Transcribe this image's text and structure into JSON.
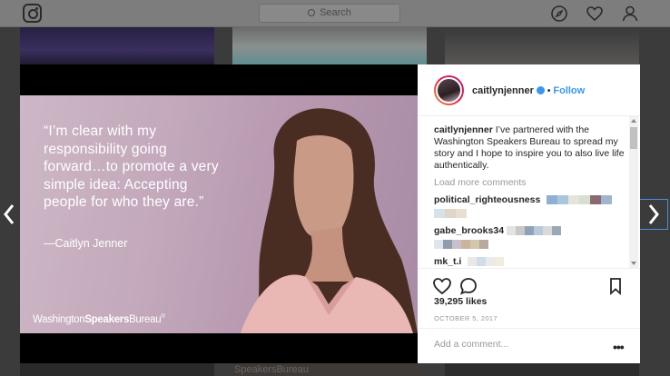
{
  "nav": {
    "search_placeholder": "Search",
    "icons": [
      "instagram-logo-icon",
      "compass-icon",
      "heart-icon",
      "user-icon"
    ]
  },
  "background": {
    "bottom_tile_text": "SpeakersBureau"
  },
  "post": {
    "image": {
      "quote": "“I’m clear with my responsibility going forward…to promote a very simple idea: Accepting people for who they are.”",
      "quote_author": "—Caitlyn Jenner",
      "brand_washington": "Washington",
      "brand_speakers": "Speakers",
      "brand_bureau": "Bureau",
      "brand_mark": "®"
    },
    "header": {
      "username": "caitlynjenner",
      "separator": "•",
      "follow_label": "Follow"
    },
    "caption": {
      "username": "caitlynjenner",
      "text": "I’ve partnered with the Washington Speakers Bureau to spread my story and I hope to inspire you to also live life authentically."
    },
    "load_more_label": "Load more comments",
    "comments": [
      {
        "username": "political_righteousness"
      },
      {
        "username": "gabe_brooks34"
      },
      {
        "username": "mk_t.i"
      }
    ],
    "likes": "39,295 likes",
    "date": "OCTOBER 5, 2017",
    "add_comment_placeholder": "Add a comment...",
    "options_label": "•••"
  },
  "colors": {
    "accent": "#3897f0",
    "text": "#262626",
    "muted": "#999999",
    "overlay": "#3b3b3b"
  }
}
